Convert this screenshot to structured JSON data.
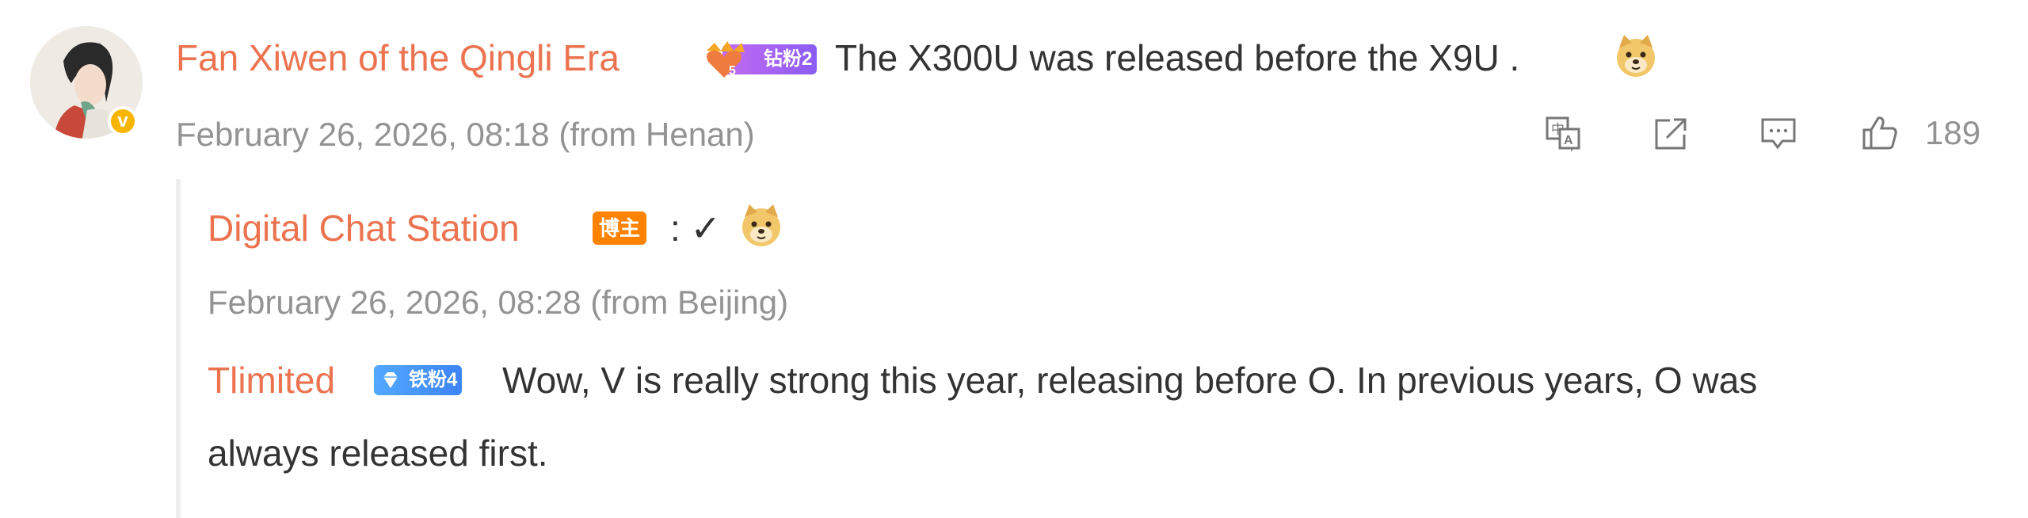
{
  "comment": {
    "username": "Fan Xiwen of the Qingli Era",
    "fan_badge": {
      "label": "钻粉2",
      "level_glyph": "5",
      "icon": "crown-heart-icon",
      "color": "#b56cf2"
    },
    "text": "The X300U was released before the X9U .",
    "emoji": "doge-emoji",
    "timestamp": "February 26, 2026, 08:18",
    "location": "(from Henan)",
    "verified_icon": "verified-v-icon",
    "actions": {
      "translate_icon": "translate-icon",
      "share_icon": "share-icon",
      "reply_icon": "comment-icon",
      "like_icon": "thumbs-up-icon",
      "like_count": "189"
    }
  },
  "replies": [
    {
      "username": "Digital Chat Station",
      "badge": "博主",
      "text": ": ✓",
      "emoji": "doge-emoji",
      "timestamp": "February 26, 2026, 08:28",
      "location": "(from Beijing)"
    },
    {
      "username": "Tlimited",
      "badge": "铁粉4",
      "badge_icon": "diamond-icon",
      "text_line1": "Wow, V is really strong this year, releasing before O. In previous years, O was",
      "text_line2": "always released first."
    }
  ],
  "colors": {
    "username": "#eb7350",
    "body_text": "#333333",
    "meta_text": "#939393",
    "blogger_badge": "#ff8200",
    "iron_fan_badge": "#4a96fb",
    "verified": "#f7b500"
  }
}
